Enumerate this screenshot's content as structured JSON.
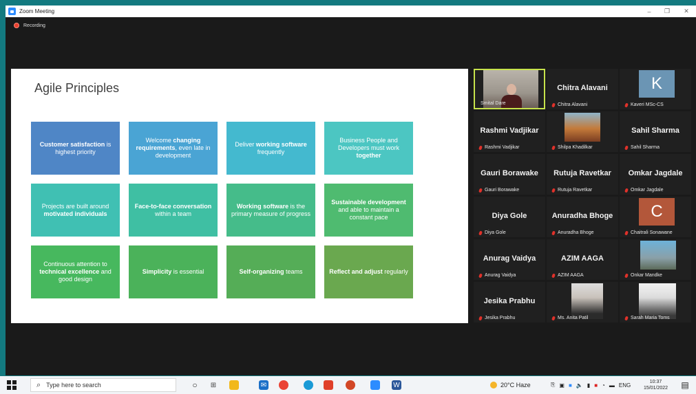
{
  "window": {
    "title": "Zoom Meeting"
  },
  "recording_label": "Recording",
  "slide": {
    "title": "Agile Principles",
    "tiles": [
      {
        "pre": "",
        "bold": "Customer satisfaction",
        "post": " is highest priority",
        "color": "#4f86c6"
      },
      {
        "pre": "Welcome ",
        "bold": "changing requirements",
        "post": ", even late in development",
        "color": "#4aa4d4"
      },
      {
        "pre": "Deliver ",
        "bold": "working software",
        "post": " frequently",
        "color": "#44b9cf"
      },
      {
        "pre": "Business People and Developers must work ",
        "bold": "together",
        "post": "",
        "color": "#4cc6c2"
      },
      {
        "pre": "Projects are built around ",
        "bold": "motivated individuals",
        "post": "",
        "color": "#40c0b3"
      },
      {
        "pre": "",
        "bold": "Face-to-face conversation",
        "post": " within a team",
        "color": "#3fbfa3"
      },
      {
        "pre": "",
        "bold": "Working software",
        "post": " is the primary measure of progress",
        "color": "#45bc8a"
      },
      {
        "pre": "",
        "bold": "Sustainable development",
        "post": " and able to maintain a constant pace",
        "color": "#4fbb70"
      },
      {
        "pre": "Continuous attention to ",
        "bold": "technical excellence",
        "post": " and good design",
        "color": "#47b85e"
      },
      {
        "pre": "",
        "bold": "Simplicity",
        "post": " is essential",
        "color": "#4bb25a"
      },
      {
        "pre": "",
        "bold": "Self-organizing",
        "post": " teams",
        "color": "#55ad57"
      },
      {
        "pre": "",
        "bold": "Reflect and adjust",
        "post": " regularly",
        "color": "#6aa84f"
      }
    ]
  },
  "participants": [
    {
      "big": "",
      "name": "Smital Dare",
      "type": "video",
      "active": true
    },
    {
      "big": "Chitra Alavani",
      "name": "Chitra Alavani",
      "type": "name"
    },
    {
      "big": "K",
      "name": "Kaveri MSc-CS",
      "type": "letter",
      "avatar_color": "#6b95b4"
    },
    {
      "big": "Rashmi Vadjikar",
      "name": "Rashmi Vadjikar",
      "type": "name"
    },
    {
      "big": "",
      "name": "Shilpa Khadilkar",
      "type": "photo"
    },
    {
      "big": "Sahil Sharma",
      "name": "Sahil Sharma",
      "type": "name"
    },
    {
      "big": "Gauri Borawake",
      "name": "Gauri Borawake",
      "type": "name"
    },
    {
      "big": "Rutuja Ravetkar",
      "name": "Rutuja Ravetkar",
      "type": "name"
    },
    {
      "big": "Omkar Jagdale",
      "name": "Omkar Jagdale",
      "type": "name"
    },
    {
      "big": "Diya Gole",
      "name": "Diya Gole",
      "type": "name"
    },
    {
      "big": "Anuradha Bhoge",
      "name": "Anuradha Bhoge",
      "type": "name"
    },
    {
      "big": "C",
      "name": "Chaitrali Sonawane",
      "type": "letter",
      "avatar_color": "#b3573a"
    },
    {
      "big": "Anurag Vaidya",
      "name": "Anurag Vaidya",
      "type": "name"
    },
    {
      "big": "AZIM AAGA",
      "name": "AZIM AAGA",
      "type": "name"
    },
    {
      "big": "",
      "name": "Onkar Mandke",
      "type": "photo"
    },
    {
      "big": "Jesika Prabhu",
      "name": "Jesika Prabhu",
      "type": "name"
    },
    {
      "big": "",
      "name": "Ms. Anita Patil",
      "type": "photo"
    },
    {
      "big": "",
      "name": "Sarah Maria Toms",
      "type": "photo"
    }
  ],
  "taskbar": {
    "search_placeholder": "Type here to search",
    "weather": "20°C Haze",
    "lang": "ENG",
    "time": "10:37",
    "date": "15/01/2022"
  }
}
